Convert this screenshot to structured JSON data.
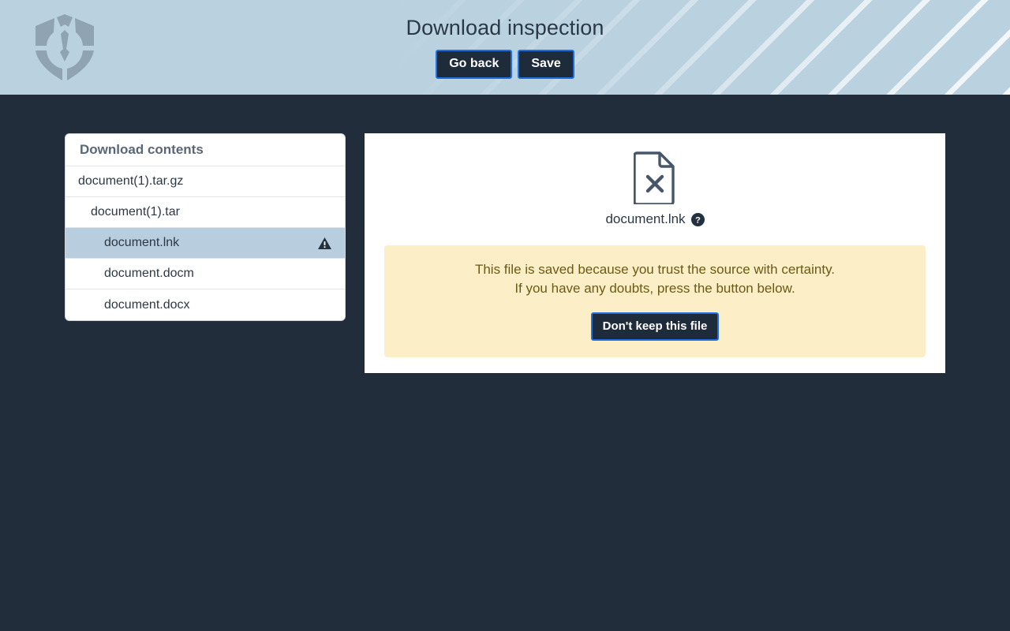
{
  "header": {
    "title": "Download inspection",
    "logo_icon": "shield-logo-icon",
    "buttons": [
      {
        "label": "Go back",
        "name": "go-back-button"
      },
      {
        "label": "Save",
        "name": "save-button"
      }
    ]
  },
  "sidebar": {
    "title": "Download contents",
    "items": [
      {
        "label": "document(1).tar.gz",
        "indent": 0,
        "selected": false,
        "warning": false
      },
      {
        "label": "document(1).tar",
        "indent": 1,
        "selected": false,
        "warning": false
      },
      {
        "label": "document.lnk",
        "indent": 2,
        "selected": true,
        "warning": true
      },
      {
        "label": "document.docm",
        "indent": 2,
        "selected": false,
        "warning": false
      },
      {
        "label": "document.docx",
        "indent": 2,
        "selected": false,
        "warning": false
      }
    ],
    "warning_icon": "warning-triangle-icon"
  },
  "main": {
    "file_icon": "file-x-icon",
    "file_name": "document.lnk",
    "help_icon": "help-circle-icon",
    "alert": {
      "line1": "This file is saved because you trust the source with certainty.",
      "line2": "If you have any doubts, press the button below.",
      "button_label": "Don't keep this file"
    }
  },
  "colors": {
    "header_bg": "#bad2e0",
    "page_bg": "#212d3b",
    "panel_bg": "#ffffff",
    "selected_row": "#b8cddd",
    "alert_bg": "#fcefc8",
    "alert_text": "#6b5a12",
    "button_bg": "#1d2b3a",
    "button_border": "#1f6fe0"
  }
}
